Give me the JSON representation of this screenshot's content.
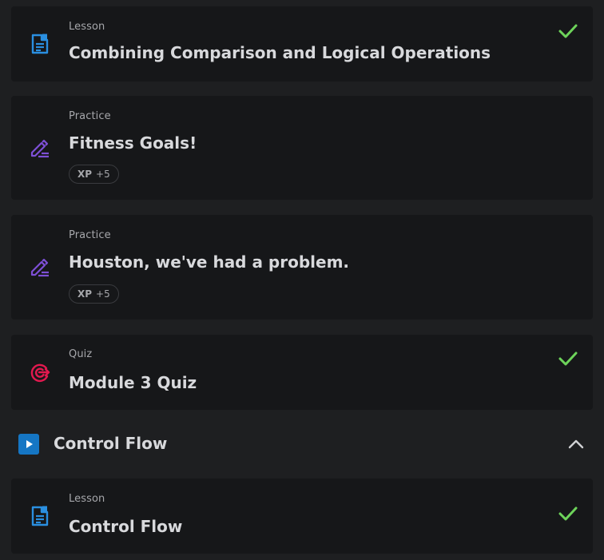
{
  "items": [
    {
      "kind": "Lesson",
      "title": "Combining Comparison and Logical Operations",
      "icon": "lesson-document-icon",
      "completed": true
    },
    {
      "kind": "Practice",
      "title": "Fitness Goals!",
      "icon": "practice-pencil-icon",
      "xp_label": "XP",
      "xp_value": "+5",
      "completed": false
    },
    {
      "kind": "Practice",
      "title": "Houston, we've had a problem.",
      "icon": "practice-pencil-icon",
      "xp_label": "XP",
      "xp_value": "+5",
      "completed": false
    },
    {
      "kind": "Quiz",
      "title": "Module 3 Quiz",
      "icon": "quiz-target-icon",
      "completed": true
    }
  ],
  "section": {
    "title": "Control Flow",
    "icon": "play-icon",
    "expanded": true,
    "items": [
      {
        "kind": "Lesson",
        "title": "Control Flow",
        "icon": "lesson-document-icon",
        "completed": true
      }
    ]
  },
  "colors": {
    "background": "#1e1f21",
    "card": "#161719",
    "lesson_icon": "#2a8fe0",
    "practice_icon": "#7e4fd6",
    "quiz_icon": "#e2194f",
    "check": "#6dd35a",
    "section_icon_bg": "#1576c4"
  }
}
